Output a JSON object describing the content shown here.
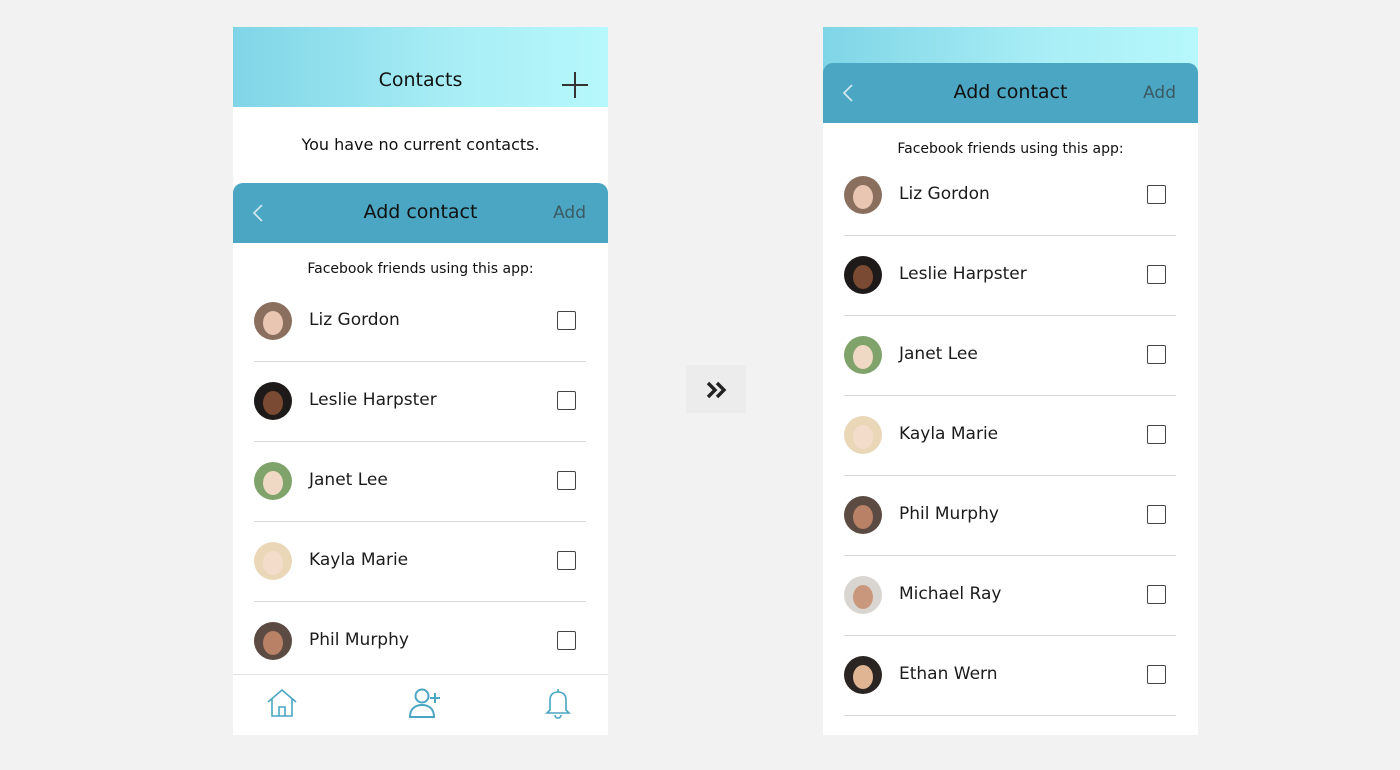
{
  "left_screen": {
    "header_title": "Contacts",
    "empty_message": "You have no current contacts.",
    "sheet": {
      "title": "Add contact",
      "action": "Add",
      "facebook_label": "Facebook friends using this app:"
    },
    "contacts": [
      {
        "name": "Liz Gordon"
      },
      {
        "name": "Leslie Harpster"
      },
      {
        "name": "Janet Lee"
      },
      {
        "name": "Kayla Marie"
      },
      {
        "name": "Phil Murphy"
      }
    ],
    "tab_bar": [
      "home-icon",
      "add-contact-icon",
      "bell-icon"
    ]
  },
  "right_screen": {
    "sheet": {
      "title": "Add contact",
      "action": "Add",
      "facebook_label": "Facebook friends using this app:"
    },
    "contacts": [
      {
        "name": "Liz Gordon"
      },
      {
        "name": "Leslie Harpster"
      },
      {
        "name": "Janet Lee"
      },
      {
        "name": "Kayla Marie"
      },
      {
        "name": "Phil Murphy"
      },
      {
        "name": "Michael Ray"
      },
      {
        "name": "Ethan Wern"
      }
    ]
  },
  "transition_icon": "double-chevron-right-icon",
  "colors": {
    "header_gradient_start": "#7fd5e6",
    "header_gradient_end": "#b6f8fb",
    "sheet_header": "#4aa6c3",
    "tab_icon": "#4aa6c3",
    "add_action": "#3c5a63"
  }
}
